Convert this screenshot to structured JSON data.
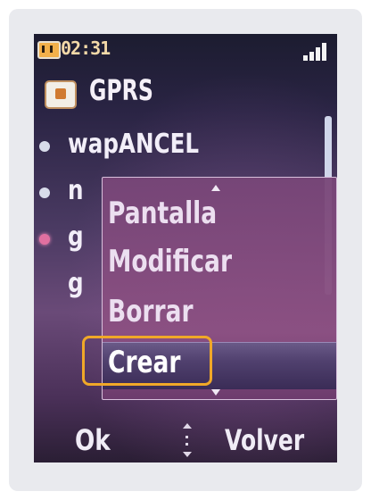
{
  "status_bar": {
    "time": "02:31",
    "battery_icon": "battery-icon",
    "signal_icon": "signal-strength-icon"
  },
  "header": {
    "title": "GPRS",
    "icon": "folder-icon"
  },
  "list": {
    "items": [
      {
        "label": "wapANCEL"
      },
      {
        "label": "n"
      },
      {
        "label": "g"
      },
      {
        "label": "g"
      }
    ]
  },
  "popup_menu": {
    "items": [
      {
        "label": "Pantalla"
      },
      {
        "label": "Modificar"
      },
      {
        "label": "Borrar"
      },
      {
        "label": "Crear"
      }
    ],
    "selected": "Crear"
  },
  "softkeys": {
    "left": "Ok",
    "right": "Volver",
    "center_icon": "up-down-navigation-icon"
  },
  "colors": {
    "highlight_border": "#f0a828",
    "background_top": "#1c1c30",
    "background_mid": "#6a4a78"
  }
}
